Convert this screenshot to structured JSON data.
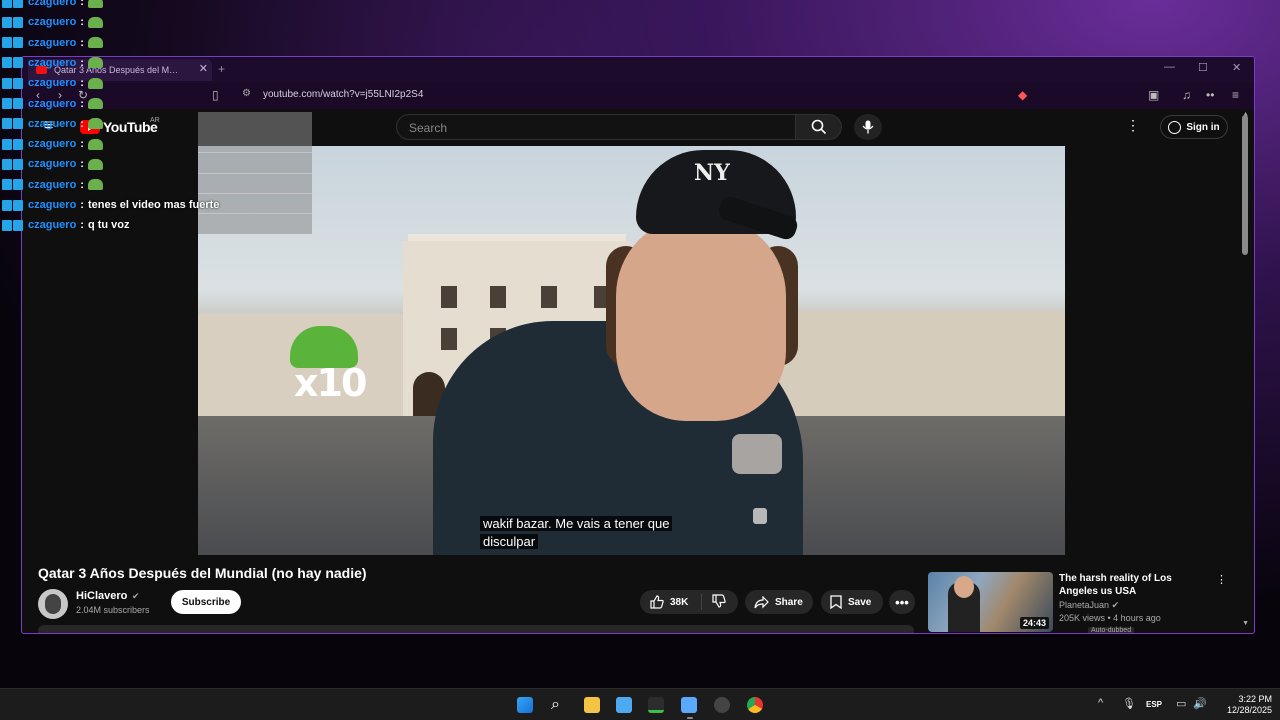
{
  "browser": {
    "tab_title": "Qatar 3 Años Después del M…",
    "url": "youtube.com/watch?v=j55LNI2p2S4"
  },
  "youtube": {
    "logo_text": "YouTube",
    "region": "AR",
    "search_placeholder": "Search",
    "signin_label": "Sign in"
  },
  "video": {
    "subtitle_line1": "wakif bazar. Me vais a tener que",
    "subtitle_line2": "disculpar",
    "emote_text": "x10",
    "cap_logo": "NY",
    "title": "Qatar 3 Años Después del Mundial (no hay nadie)",
    "channel": "HiClavero",
    "subscribers": "2.04M subscribers",
    "subscribe_label": "Subscribe",
    "likes": "38K",
    "share_label": "Share",
    "save_label": "Save"
  },
  "recommended": {
    "title": "The harsh reality of Los Angeles us USA",
    "channel": "PlanetaJuan",
    "meta": "205K views • 4 hours ago",
    "duration": "24:43",
    "badge": "Auto-dubbed"
  },
  "chat": {
    "user": "czaguero",
    "colon": ":",
    "messages": [
      {
        "text": "",
        "emote": true
      },
      {
        "text": "",
        "emote": true
      },
      {
        "text": "",
        "emote": true
      },
      {
        "text": "",
        "emote": true
      },
      {
        "text": "",
        "emote": true
      },
      {
        "text": "",
        "emote": true
      },
      {
        "text": "",
        "emote": true
      },
      {
        "text": "",
        "emote": true
      },
      {
        "text": "",
        "emote": true
      },
      {
        "text": "",
        "emote": true
      },
      {
        "text": "tenes el video mas fuerte",
        "emote": false
      },
      {
        "text": "q tu voz",
        "emote": false
      }
    ]
  },
  "taskbar": {
    "language": "ESP",
    "time": "3:22 PM",
    "date": "12/28/2025"
  },
  "icons": [
    "menu-icon",
    "search-icon",
    "mic-icon",
    "more-vert-icon",
    "account-icon",
    "like-icon",
    "dislike-icon",
    "share-icon",
    "save-icon",
    "windows-icon",
    "chrome-icon"
  ],
  "colors": {
    "accent_border": "#7a3cc8",
    "chat_user": "#1e90ff",
    "youtube_red": "#ff0000"
  }
}
